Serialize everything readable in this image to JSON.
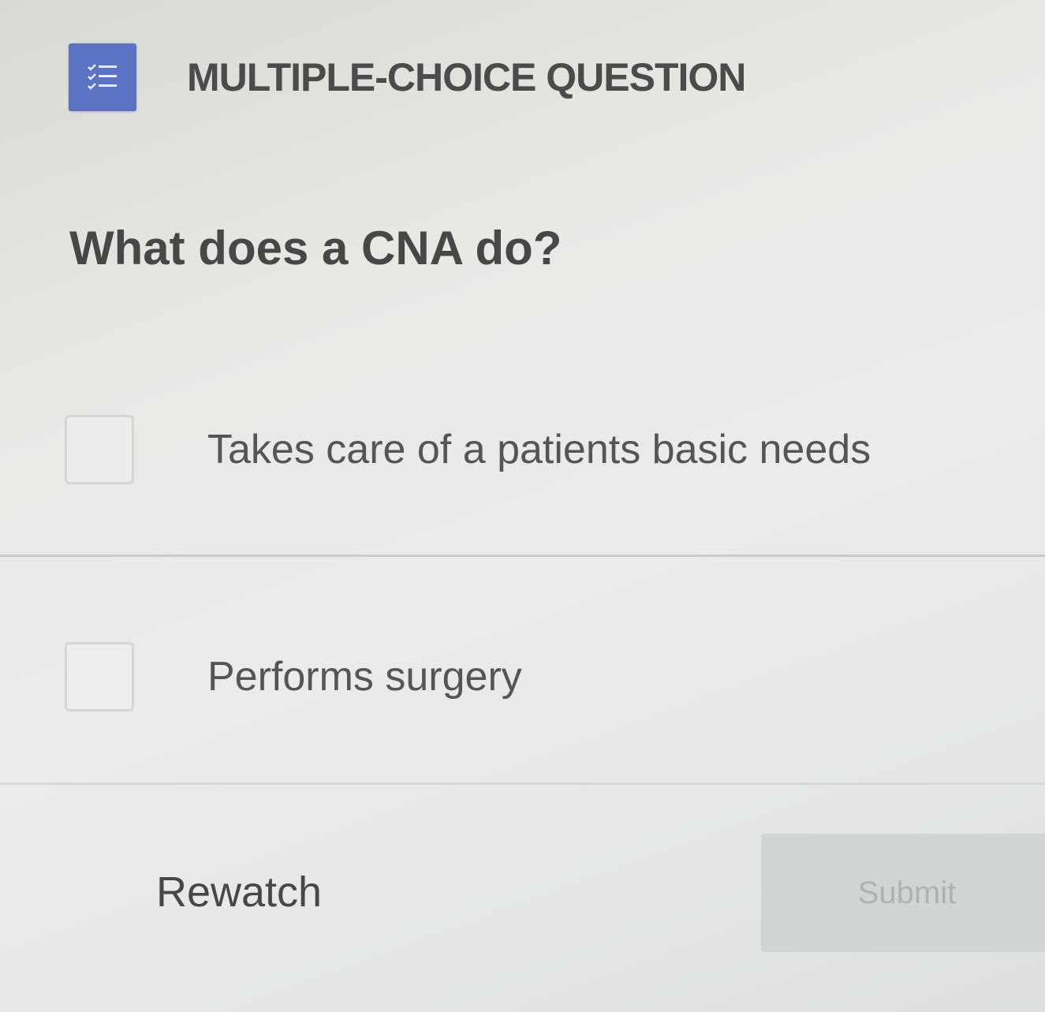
{
  "header": {
    "icon": "checklist-icon",
    "title": "MULTIPLE-CHOICE QUESTION",
    "accent_color": "#5b73c2"
  },
  "question": {
    "text": "What does a CNA do?"
  },
  "options": [
    {
      "label": "Takes care of a patients basic needs",
      "checked": false
    },
    {
      "label": "Performs surgery",
      "checked": false
    }
  ],
  "actions": {
    "rewatch_label": "Rewatch",
    "submit_label": "Submit",
    "submit_enabled": false
  }
}
